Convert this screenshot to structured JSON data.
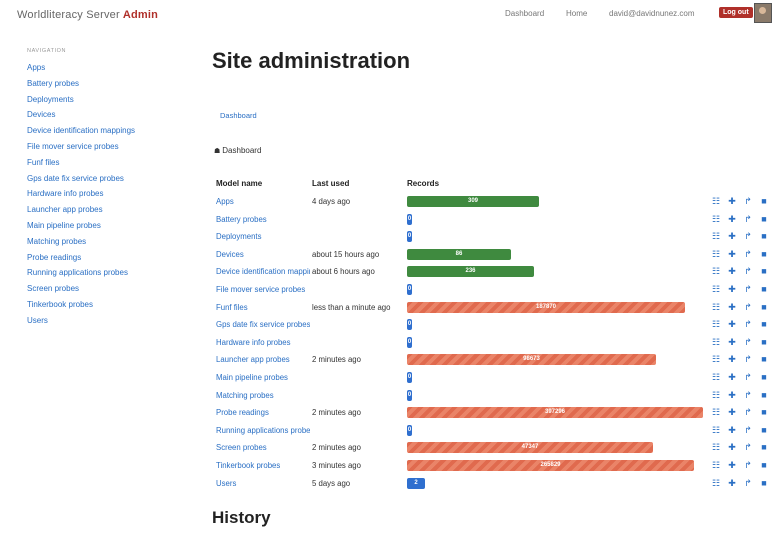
{
  "header": {
    "brand": "Worldliteracy Server",
    "brand_suffix": "Admin",
    "nav": [
      "Dashboard",
      "Home",
      "david@davidnunez.com"
    ],
    "logout": "Log out",
    "accent_color": "#b0302a"
  },
  "sidebar": {
    "heading": "NAVIGATION",
    "items": [
      "Apps",
      "Battery probes",
      "Deployments",
      "Devices",
      "Device identification mappings",
      "File mover service probes",
      "Funf files",
      "Gps date fix service probes",
      "Hardware info probes",
      "Launcher app probes",
      "Main pipeline probes",
      "Matching probes",
      "Probe readings",
      "Running applications probes",
      "Screen probes",
      "Tinkerbook probes",
      "Users"
    ]
  },
  "main": {
    "title": "Site administration",
    "crumb_link": "Dashboard",
    "breadcrumb": "Dashboard",
    "table": {
      "headers": [
        "Model name",
        "Last used",
        "Records"
      ],
      "rows": [
        {
          "name": "Apps",
          "last_used": "4 days ago",
          "records": "309",
          "fill": 0.445,
          "color": "green"
        },
        {
          "name": "Battery probes",
          "last_used": "",
          "records": "0",
          "fill": 0.0,
          "color": "blue"
        },
        {
          "name": "Deployments",
          "last_used": "",
          "records": "0",
          "fill": 0.0,
          "color": "blue"
        },
        {
          "name": "Devices",
          "last_used": "about 15 hours ago",
          "records": "86",
          "fill": 0.35,
          "color": "green"
        },
        {
          "name": "Device identification mappings",
          "last_used": "about 6 hours ago",
          "records": "236",
          "fill": 0.43,
          "color": "green"
        },
        {
          "name": "File mover service probes",
          "last_used": "",
          "records": "0",
          "fill": 0.0,
          "color": "blue"
        },
        {
          "name": "Funf files",
          "last_used": "less than a minute ago",
          "records": "187870",
          "fill": 0.94,
          "color": "red"
        },
        {
          "name": "Gps date fix service probes",
          "last_used": "",
          "records": "0",
          "fill": 0.0,
          "color": "blue"
        },
        {
          "name": "Hardware info probes",
          "last_used": "",
          "records": "0",
          "fill": 0.0,
          "color": "blue"
        },
        {
          "name": "Launcher app probes",
          "last_used": "2 minutes ago",
          "records": "98673",
          "fill": 0.84,
          "color": "red"
        },
        {
          "name": "Main pipeline probes",
          "last_used": "",
          "records": "0",
          "fill": 0.0,
          "color": "blue"
        },
        {
          "name": "Matching probes",
          "last_used": "",
          "records": "0",
          "fill": 0.0,
          "color": "blue"
        },
        {
          "name": "Probe readings",
          "last_used": "2 minutes ago",
          "records": "397296",
          "fill": 1.0,
          "color": "red"
        },
        {
          "name": "Running applications probes",
          "last_used": "",
          "records": "0",
          "fill": 0.0,
          "color": "blue"
        },
        {
          "name": "Screen probes",
          "last_used": "2 minutes ago",
          "records": "47347",
          "fill": 0.83,
          "color": "red"
        },
        {
          "name": "Tinkerbook probes",
          "last_used": "3 minutes ago",
          "records": "265829",
          "fill": 0.97,
          "color": "red"
        },
        {
          "name": "Users",
          "last_used": "5 days ago",
          "records": "2",
          "fill": 0.06,
          "color": "blue"
        }
      ],
      "action_icons": [
        "list-icon",
        "plus-icon",
        "export-icon",
        "book-icon"
      ]
    },
    "history_title": "History"
  }
}
